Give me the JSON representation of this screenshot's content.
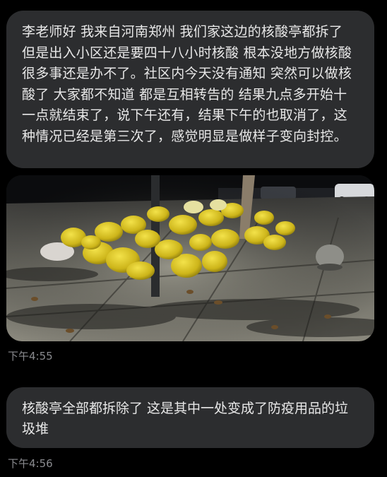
{
  "messages": [
    {
      "text": "李老师好 我来自河南郑州 我们家这边的核酸亭都拆了 但是出入小区还是要四十八小时核酸 根本没地方做核酸 很多事还是办不了。社区内今天没有通知 突然可以做核酸了 大家都不知道 都是互相转告的 结果九点多开始十一点就结束了，说下午还有，结果下午的也取消了，这种情况已经是第三次了，感觉明显是做样子变向封控。"
    },
    {
      "time": "下午4:55"
    },
    {
      "text": "核酸亭全部都拆除了 这是其中一处变成了防疫用品的垃圾堆",
      "time": "下午4:56"
    }
  ],
  "colors": {
    "background": "#000000",
    "bubble": "#2c2d2f",
    "text": "#e8e8e8",
    "timestamp": "#8a8b8f",
    "waste_bags": "#d8c21c"
  }
}
